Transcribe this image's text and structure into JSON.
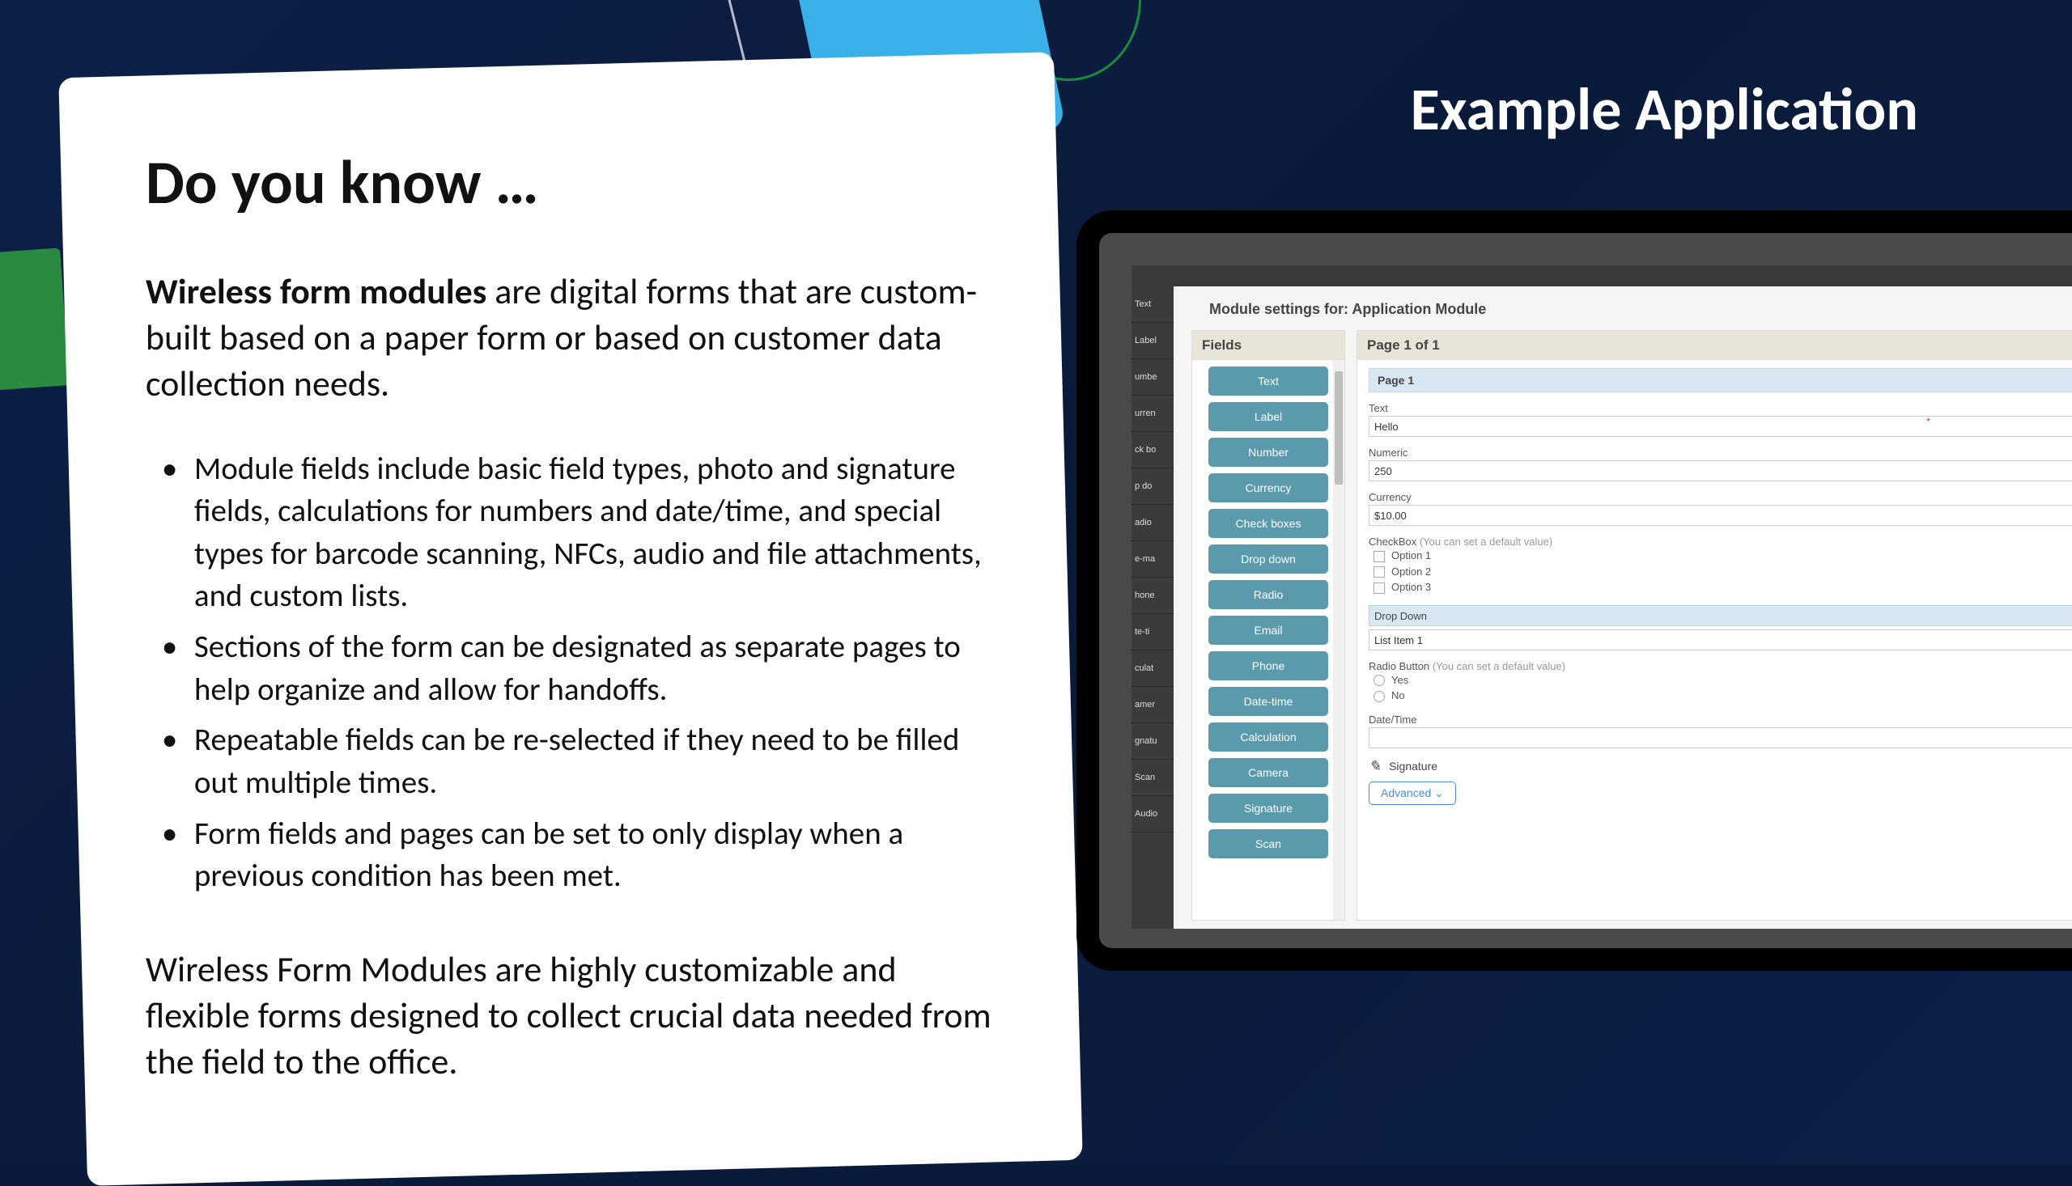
{
  "header": {
    "title": "Example Application"
  },
  "card": {
    "heading": "Do you know …",
    "intro_bold": "Wireless form modules",
    "intro_rest": " are digital forms that are custom-built based on a paper form or based on customer data collection needs.",
    "bullets": [
      "Module fields include basic field types, photo and signature fields, calculations for numbers and date/time, and special types for barcode scanning, NFCs, audio and file attachments, and custom lists.",
      "Sections of the form can be designated as separate pages to help organize and allow for handoffs.",
      "Repeatable fields can be re-selected if they need to be filled out multiple times.",
      "Form fields and pages can be set to only display when a previous condition has been met."
    ],
    "closing": "Wireless Form Modules are highly customizable and flexible forms designed to collect crucial data needed from the field to the office."
  },
  "app": {
    "module_title": "Module settings for: Application Module",
    "fields_header": "Fields",
    "page_header": "Page 1 of 1",
    "page_title": "Page 1",
    "side_items": [
      "Text",
      "Label",
      "umbe",
      "urren",
      "ck bo",
      "p do",
      "adio",
      "e-ma",
      "hone",
      "te-ti",
      "culat",
      "amer",
      "gnatu",
      "Scan",
      "Audio"
    ],
    "field_buttons": [
      "Text",
      "Label",
      "Number",
      "Currency",
      "Check boxes",
      "Drop down",
      "Radio",
      "Email",
      "Phone",
      "Date-time",
      "Calculation",
      "Camera",
      "Signature",
      "Scan"
    ],
    "form": {
      "text_label": "Text",
      "text_value": "Hello",
      "numeric_label": "Numeric",
      "numeric_value": "250",
      "currency_label": "Currency",
      "currency_value": "$10.00",
      "checkbox_label": "CheckBox",
      "checkbox_hint": "(You can set a default value)",
      "checkbox_options": [
        "Option 1",
        "Option 2",
        "Option 3"
      ],
      "dropdown_label": "Drop Down",
      "dropdown_value": "List Item 1",
      "radio_label": "Radio Button",
      "radio_hint": "(You can set a default value)",
      "radio_options": [
        "Yes",
        "No"
      ],
      "datetime_label": "Date/Time",
      "datetime_value": "",
      "signature_label": "Signature",
      "advanced_label": "Advanced"
    }
  }
}
